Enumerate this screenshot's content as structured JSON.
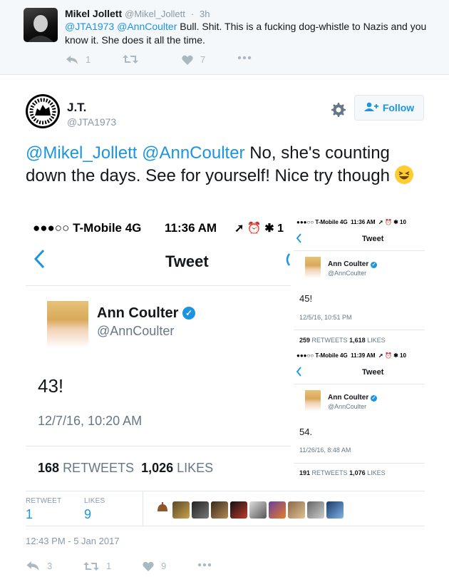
{
  "reply": {
    "name": "Mikel Jollett",
    "handle": "@Mikel_Jollett",
    "dot": "·",
    "time": "3h",
    "mention1": "@JTA1973",
    "mention2": "@AnnCoulter",
    "text": " Bull. Shit. This is a fucking dog-whistle to Nazis and you know it. She does it all the time.",
    "replies": "1",
    "likes": "7",
    "icons": [
      "reply-icon",
      "retweet-icon",
      "heart-icon",
      "more-icon"
    ]
  },
  "tweet": {
    "name": "J.T.",
    "handle": "@JTA1973",
    "follow_label": "Follow",
    "mention1": "@Mikel_Jollett",
    "mention2": "@AnnCoulter",
    "text": " No, she's counting down the days. See for yourself! Nice try though ",
    "emoji": "grinning-squinting-face-emoji"
  },
  "screenshot": {
    "big": {
      "carrier": "●●●○○ T-Mobile  4G",
      "time": "11:36 AM",
      "status_icons": "➚ ⏰ ✱ 1",
      "title": "Tweet",
      "name": "Ann Coulter",
      "handle": "@AnnCoulter",
      "text": "43!",
      "date": "12/7/16, 10:20 AM",
      "retweets": "168",
      "retweets_label": "RETWEETS",
      "likes": "1,026",
      "likes_label": "LIKES"
    },
    "small1": {
      "carrier": "●●●○○ T-Mobile  4G",
      "time": "11:36 AM",
      "status_icons": "➚ ⏰ ✱ 10",
      "title": "Tweet",
      "name": "Ann Coulter",
      "handle": "@AnnCoulter",
      "text": "45!",
      "date": "12/5/16, 10:51 PM",
      "retweets": "259",
      "retweets_label": "RETWEETS",
      "likes": "1,618",
      "likes_label": "LIKES"
    },
    "small2": {
      "carrier": "●●●○○ T-Mobile  4G",
      "time": "11:39 AM",
      "status_icons": "➚ ⏰ ✱ 10",
      "title": "Tweet",
      "name": "Ann Coulter",
      "handle": "@AnnCoulter",
      "text": "54.",
      "date": "11/26/16, 8:48 AM",
      "retweets": "191",
      "retweets_label": "RETWEETS",
      "likes": "1,076",
      "likes_label": "LIKES"
    }
  },
  "stats": {
    "retweet_label": "RETWEET",
    "retweet_count": "1",
    "likes_label": "LIKES",
    "likes_count": "9"
  },
  "timestamp": "12:43 PM - 5 Jan 2017",
  "footer": {
    "replies": "3",
    "retweets": "1",
    "likes": "9"
  },
  "colors": {
    "link": "#1b95e0",
    "muted": "#8899a6",
    "border": "#e1e8ed"
  }
}
